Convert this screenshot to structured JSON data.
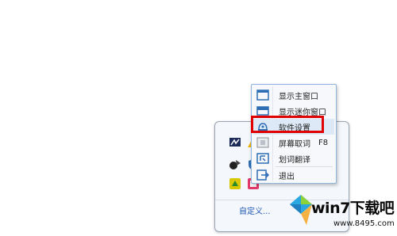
{
  "tray": {
    "customize_label": "自定义...",
    "icons": [
      "app-tray-icon",
      "alert-tray-icon",
      "network-tray-icon",
      "shield-tray-icon",
      "qq-tray-icon",
      "dictionary-tray-icon"
    ]
  },
  "menu": {
    "items": [
      {
        "label": "显示主窗口",
        "icon": "window-icon",
        "shortcut": ""
      },
      {
        "label": "显示迷你窗口",
        "icon": "mini-window-icon",
        "shortcut": ""
      },
      {
        "label": "软件设置",
        "icon": "settings-icon",
        "shortcut": ""
      },
      {
        "label": "屏幕取词",
        "icon": "screen-capture-icon",
        "shortcut": "F8"
      },
      {
        "label": "划词翻译",
        "icon": "select-translate-icon",
        "shortcut": ""
      },
      {
        "label": "退出",
        "icon": "exit-icon",
        "shortcut": ""
      }
    ],
    "highlighted_item": "软件设置"
  },
  "watermark": {
    "brand": "win7下载吧",
    "url": "www.8495.com"
  },
  "colors": {
    "highlight_border": "#e00000",
    "menu_border": "#8fb5dc",
    "icon_blue": "#2f6db5"
  }
}
